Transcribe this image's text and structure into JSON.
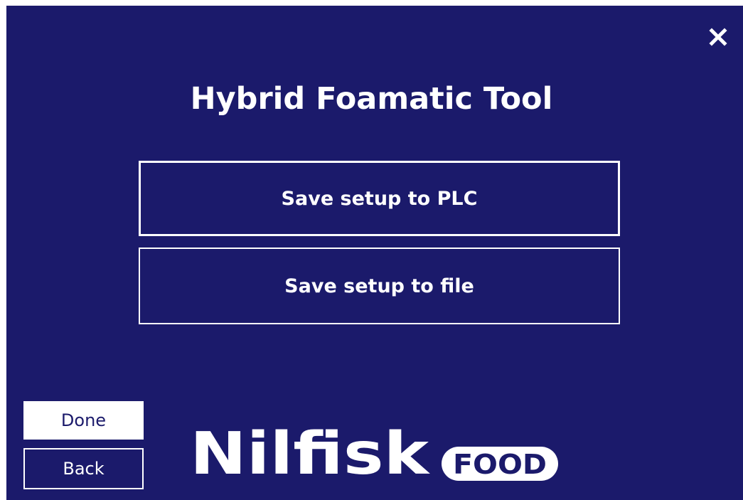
{
  "dialog": {
    "title": "Hybrid Foamatic Tool",
    "close_icon": "close-icon"
  },
  "actions": {
    "save_plc_label": "Save setup to PLC",
    "save_file_label": "Save setup to file"
  },
  "footer": {
    "done_label": "Done",
    "back_label": "Back"
  },
  "logo": {
    "brand": "Nilfisk",
    "badge": "FOOD"
  },
  "colors": {
    "background": "#1b1a6b",
    "foreground": "#ffffff"
  }
}
